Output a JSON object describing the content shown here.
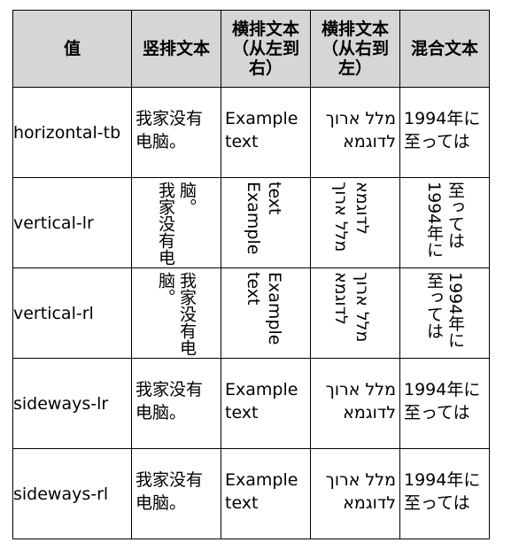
{
  "headers": [
    "值",
    "竖排文本",
    "横排文本\n（从左到\n右）",
    "横排文本\n（从右到\n左）",
    "混合文本"
  ],
  "rows": [
    {
      "value": "horizontal-tb",
      "cjk": "我家没有电脑。",
      "ltr": "Example text",
      "rtl": "מלל ארוך לדוגמא",
      "mixed": "1994年に至っては"
    },
    {
      "value": "vertical-lr",
      "cjk": "我家没有电脑。",
      "ltr": "Example text",
      "rtl": "מלל ארוך לדוגמא",
      "mixed": "1994年に至っては"
    },
    {
      "value": "vertical-rl",
      "cjk": "我家没有电脑。",
      "ltr": "Example text",
      "rtl": "מלל ארוך לדוגמא",
      "mixed": "1994年に至っては"
    },
    {
      "value": "sideways-lr",
      "cjk": "我家没有电脑。",
      "ltr": "Example text",
      "rtl": "מלל ארוך לדוגמא",
      "mixed": "1994年に至っては"
    },
    {
      "value": "sideways-rl",
      "cjk": "我家没有电脑。",
      "ltr": "Example text",
      "rtl": "מלל ארוך לדוגמא",
      "mixed": "1994年に至っては"
    }
  ]
}
